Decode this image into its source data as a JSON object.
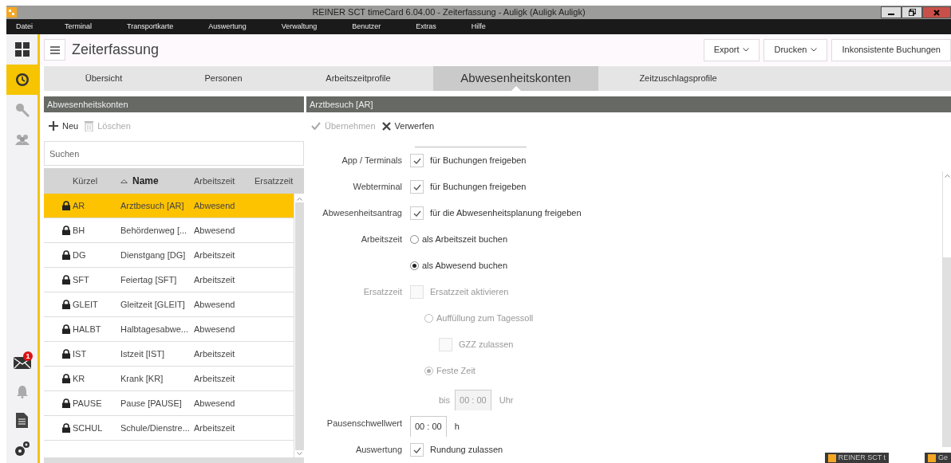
{
  "window": {
    "title": "REINER SCT timeCard 6.04.00 - Zeiterfassung - Auligk (Auligk Auligk)"
  },
  "menu": [
    "Datei",
    "Terminal",
    "Transportkarte",
    "Auswertung",
    "Verwaltung",
    "Benutzer",
    "Extras",
    "Hilfe"
  ],
  "sidebar": {
    "top_items": [
      {
        "selected": false
      },
      {
        "selected": true
      },
      {
        "selected": false
      },
      {
        "selected": false
      }
    ],
    "mail_badge": "1"
  },
  "header": {
    "title": "Zeiterfassung",
    "buttons": [
      {
        "label": "Export",
        "dropdown": true
      },
      {
        "label": "Drucken",
        "dropdown": true
      },
      {
        "label": "Inkonsistente Buchungen",
        "dropdown": false
      }
    ]
  },
  "tabs": [
    {
      "label": "Übersicht",
      "selected": false
    },
    {
      "label": "Personen",
      "selected": false
    },
    {
      "label": "Arbeitszeitprofile",
      "selected": false
    },
    {
      "label": "Abwesenheitskonten",
      "selected": true
    },
    {
      "label": "Zeitzuschlagsprofile",
      "selected": false
    }
  ],
  "left_panel": {
    "title": "Abwesenheitskonten",
    "toolbar": [
      {
        "label": "Neu",
        "disabled": false
      },
      {
        "label": "Löschen",
        "disabled": true
      }
    ],
    "search": {
      "placeholder": "Suchen"
    },
    "table": {
      "columns": [
        {
          "label": "Kürzel",
          "sorted": false
        },
        {
          "label": "Name",
          "sorted": true
        },
        {
          "label": "Arbeitszeit",
          "sorted": false
        },
        {
          "label": "Ersatzzeit",
          "sorted": false
        }
      ],
      "rows": [
        {
          "code": "AR",
          "name": "Arztbesuch [AR]",
          "arbeitszeit": "Abwesend",
          "locked": true,
          "selected": true
        },
        {
          "code": "BH",
          "name": "Behördenweg [...",
          "arbeitszeit": "Abwesend",
          "locked": true,
          "selected": false
        },
        {
          "code": "DG",
          "name": "Dienstgang [DG]",
          "arbeitszeit": "Arbeitszeit",
          "locked": true,
          "selected": false
        },
        {
          "code": "SFT",
          "name": "Feiertag [SFT]",
          "arbeitszeit": "Arbeitszeit",
          "locked": true,
          "selected": false
        },
        {
          "code": "GLEIT",
          "name": "Gleitzeit [GLEIT]",
          "arbeitszeit": "Abwesend",
          "locked": true,
          "selected": false
        },
        {
          "code": "HALBT",
          "name": "Halbtagesabwe...",
          "arbeitszeit": "Abwesend",
          "locked": true,
          "selected": false
        },
        {
          "code": "IST",
          "name": "Istzeit [IST]",
          "arbeitszeit": "Arbeitszeit",
          "locked": true,
          "selected": false
        },
        {
          "code": "KR",
          "name": "Krank [KR]",
          "arbeitszeit": "Arbeitszeit",
          "locked": true,
          "selected": false
        },
        {
          "code": "PAUSE",
          "name": "Pause [PAUSE]",
          "arbeitszeit": "Abwesend",
          "locked": true,
          "selected": false
        },
        {
          "code": "SCHUL",
          "name": "Schule/Dienstre...",
          "arbeitszeit": "Arbeitszeit",
          "locked": true,
          "selected": false
        }
      ]
    }
  },
  "right_panel": {
    "title": "Arztbesuch [AR]",
    "toolbar": [
      {
        "label": "Übernehmen",
        "disabled": true
      },
      {
        "label": "Verwerfen",
        "disabled": false
      }
    ],
    "form": [
      {
        "kind": "checkbox",
        "label": "App / Terminals",
        "text": "für Buchungen freigeben",
        "checked": true,
        "disabled": false
      },
      {
        "kind": "checkbox",
        "label": "Webterminal",
        "text": "für Buchungen freigeben",
        "checked": true,
        "disabled": false
      },
      {
        "kind": "checkbox",
        "label": "Abwesenheitsantrag",
        "text": "für die Abwesenheitsplanung freigeben",
        "checked": true,
        "disabled": false
      },
      {
        "kind": "radio",
        "label": "Arbeitszeit",
        "text": "als Arbeitszeit buchen",
        "selected": false,
        "disabled": false
      },
      {
        "kind": "radio",
        "text": "als Abwesend buchen",
        "selected": true,
        "disabled": false
      },
      {
        "kind": "checkbox",
        "label": "Ersatzzeit",
        "text": "Ersatzzeit aktivieren",
        "checked": false,
        "disabled": true,
        "children": [
          {
            "kind": "radio",
            "text": "Auffüllung zum Tagessoll",
            "selected": false,
            "disabled": true,
            "children": [
              {
                "kind": "checkbox",
                "text": "GZZ zulassen",
                "checked": false,
                "disabled": true
              }
            ]
          },
          {
            "kind": "radio",
            "text": "Feste Zeit",
            "selected": true,
            "disabled": true,
            "children": [
              {
                "kind": "time",
                "prefix": "bis",
                "value": "00 : 00",
                "unit": "Uhr",
                "disabled": true
              }
            ]
          }
        ]
      },
      {
        "kind": "time",
        "label": "Pausenschwellwert",
        "value": "00 : 00",
        "unit": "h",
        "disabled": false
      },
      {
        "kind": "checkbox",
        "label": "Auswertung",
        "text": "Rundung zulassen",
        "checked": true,
        "disabled": false
      }
    ]
  },
  "taskbar": [
    {
      "label": "REINER SCT t"
    },
    {
      "label": "Ge"
    }
  ]
}
